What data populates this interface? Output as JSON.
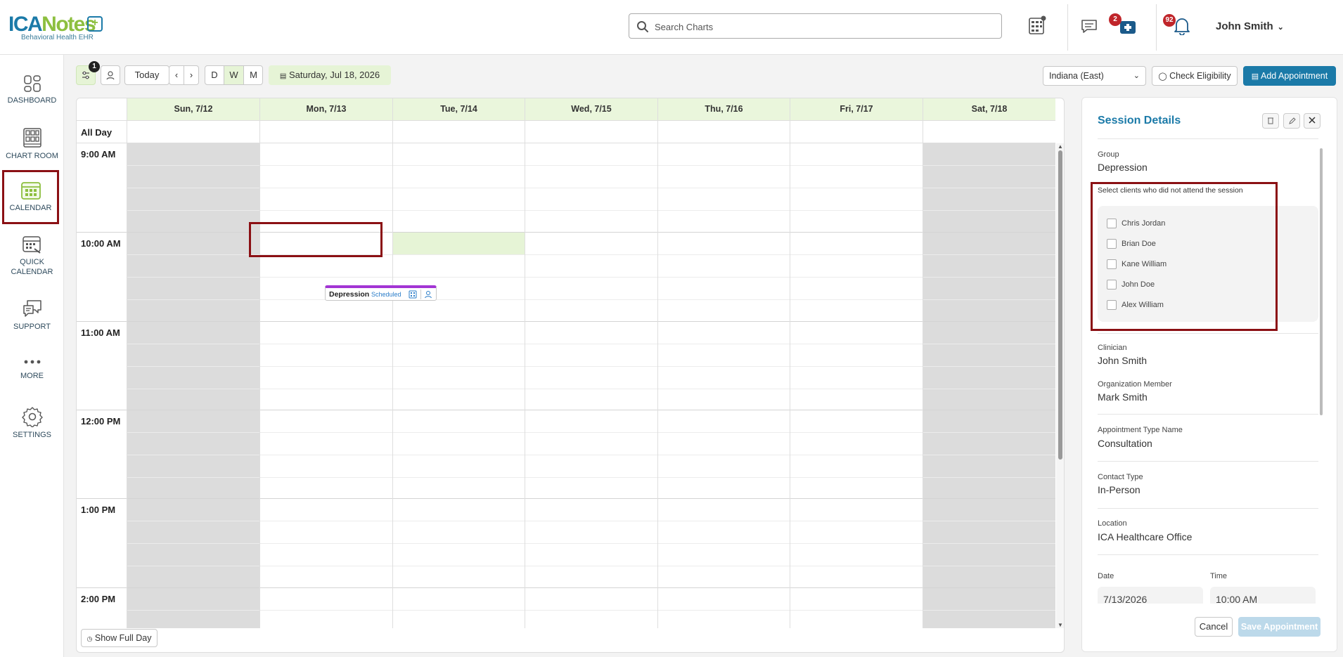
{
  "brand": {
    "name_part1": "ICA",
    "name_part2": "Notes",
    "subtitle": "Behavioral Health EHR"
  },
  "header": {
    "search_placeholder": "Search Charts",
    "badges": {
      "chat": "2",
      "notifications": "92"
    },
    "user_name": "John Smith"
  },
  "sidebar": {
    "items": [
      {
        "label": "DASHBOARD",
        "icon": "dashboard-icon"
      },
      {
        "label": "CHART ROOM",
        "icon": "chart-room-icon"
      },
      {
        "label": "CALENDAR",
        "icon": "calendar-icon"
      },
      {
        "label": "QUICK CALENDAR",
        "icon": "quick-calendar-icon"
      },
      {
        "label": "SUPPORT",
        "icon": "support-icon"
      },
      {
        "label": "MORE",
        "icon": "more-icon"
      },
      {
        "label": "SETTINGS",
        "icon": "gear-icon"
      }
    ]
  },
  "toolbar": {
    "filter_badge": "1",
    "today": "Today",
    "views": [
      "D",
      "W",
      "M"
    ],
    "active_view": "W",
    "current_date": "Saturday, Jul 18, 2026",
    "timezone": "Indiana (East)",
    "check_eligibility": "Check Eligibility",
    "add_appointment": "Add Appointment"
  },
  "calendar": {
    "all_day_label": "All Day",
    "days": [
      "Sun, 7/12",
      "Mon, 7/13",
      "Tue, 7/14",
      "Wed, 7/15",
      "Thu, 7/16",
      "Fri, 7/17",
      "Sat, 7/18"
    ],
    "times": [
      "9:00 AM",
      "10:00 AM",
      "11:00 AM",
      "12:00 PM",
      "1:00 PM",
      "2:00 PM"
    ],
    "event": {
      "title": "Depression",
      "status": "Scheduled"
    },
    "show_full_day": "Show Full Day",
    "colors": {
      "header_bg": "#eaf6dc",
      "weekend": "#dcdcdc",
      "event_bar": "#a335d4",
      "highlight": "#e6f4d6"
    }
  },
  "panel": {
    "title": "Session Details",
    "group_label": "Group",
    "group_value": "Depression",
    "attendance_prompt": "Select clients who did not attend the session",
    "clients": [
      "Chris Jordan",
      "Brian Doe",
      "Kane William",
      "John Doe",
      "Alex William"
    ],
    "clinician_label": "Clinician",
    "clinician_value": "John Smith",
    "org_member_label": "Organization Member",
    "org_member_value": "Mark Smith",
    "appt_type_label": "Appointment Type Name",
    "appt_type_value": "Consultation",
    "contact_type_label": "Contact Type",
    "contact_type_value": "In-Person",
    "location_label": "Location",
    "location_value": "ICA Healthcare Office",
    "date_label": "Date",
    "date_value": "7/13/2026",
    "time_label": "Time",
    "time_value": "10:00 AM",
    "cancel": "Cancel",
    "save": "Save Appointment"
  },
  "colors": {
    "primary": "#1b7aa8",
    "accent_green": "#8dbf3f",
    "badge_red": "#c0252a",
    "highlight_border": "#8b1014"
  }
}
